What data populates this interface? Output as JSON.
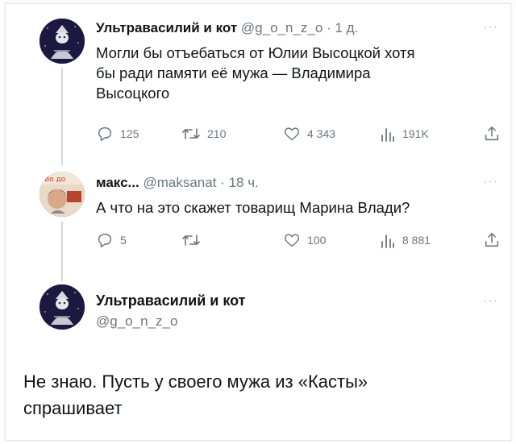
{
  "tweet1": {
    "name": "Ультравасилий и кот",
    "handle": "@g_o_n_z_o",
    "sep": "·",
    "time": "1 д.",
    "more": "···",
    "text_lines": [
      "Могли бы отъебаться от Юлии Высоцкой хотя",
      "бы ради памяти её мужа — Владимира",
      "Высоцкого"
    ],
    "actions": {
      "replies": "125",
      "retweets": "210",
      "likes": "4 343",
      "views": "191K"
    }
  },
  "tweet2": {
    "name": "макс...",
    "handle": "@maksanat",
    "sep": "·",
    "time": "18 ч.",
    "more": "···",
    "text": "А что на это скажет товарищ Марина Влади?",
    "actions": {
      "replies": "5",
      "retweets": "",
      "likes": "100",
      "views": "8 881"
    }
  },
  "tweet3": {
    "name": "Ультравасилий и кот",
    "handle": "@g_o_n_z_o",
    "more": "···",
    "text_lines": [
      "Не знаю. Пусть у своего мужа из «Касты»",
      "спрашивает"
    ]
  },
  "icons": {
    "reply": "reply-icon",
    "retweet": "retweet-icon",
    "like": "like-icon",
    "views": "views-icon",
    "share": "share-icon"
  },
  "colors": {
    "text": "#0f1419",
    "secondary": "#6a7680",
    "thread_line": "#cfd9de"
  }
}
